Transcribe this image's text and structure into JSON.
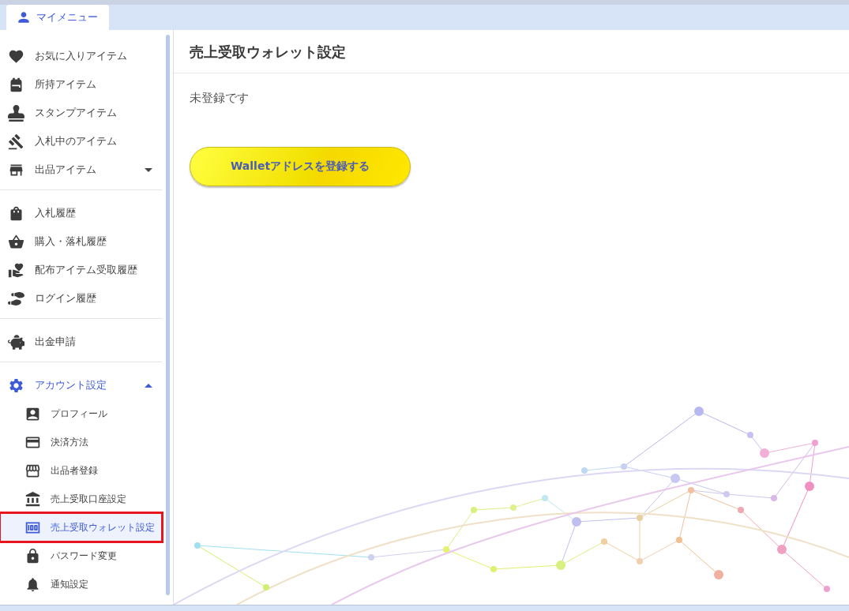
{
  "top_tab": {
    "label": "マイメニュー",
    "selected": true
  },
  "sidebar": {
    "groups": [
      {
        "items": [
          {
            "kind": "item",
            "label": "お気に入りアイテム",
            "selected": false
          },
          {
            "kind": "item",
            "label": "所持アイテム",
            "selected": false
          },
          {
            "kind": "item",
            "label": "スタンプアイテム",
            "selected": false
          },
          {
            "kind": "item",
            "label": "入札中のアイテム",
            "selected": false
          },
          {
            "kind": "expandable",
            "label": "出品アイテム",
            "selected": false,
            "expanded": false
          }
        ]
      },
      {
        "items": [
          {
            "kind": "item",
            "label": "入札履歴",
            "selected": false
          },
          {
            "kind": "item",
            "label": "購入・落札履歴",
            "selected": false
          },
          {
            "kind": "item",
            "label": "配布アイテム受取履歴",
            "selected": false
          },
          {
            "kind": "item",
            "label": "ログイン履歴",
            "selected": false
          }
        ]
      },
      {
        "items": [
          {
            "kind": "item",
            "label": "出金申請",
            "selected": false
          }
        ]
      },
      {
        "items": [
          {
            "kind": "expandable",
            "label": "アカウント設定",
            "selected": true,
            "expanded": true,
            "children": [
              {
                "label": "プロフィール",
                "selected": false,
                "highlighted": false
              },
              {
                "label": "決済方法",
                "selected": false,
                "highlighted": false
              },
              {
                "label": "出品者登録",
                "selected": false,
                "highlighted": false
              },
              {
                "label": "売上受取口座設定",
                "selected": false,
                "highlighted": false
              },
              {
                "label": "売上受取ウォレット設定",
                "selected": true,
                "highlighted": true
              },
              {
                "label": "パスワード変更",
                "selected": false,
                "highlighted": false
              },
              {
                "label": "通知設定",
                "selected": false,
                "highlighted": false
              }
            ]
          }
        ]
      }
    ]
  },
  "main": {
    "title": "売上受取ウォレット設定",
    "status": "未登録です",
    "button": "Walletアドレスを登録する"
  }
}
